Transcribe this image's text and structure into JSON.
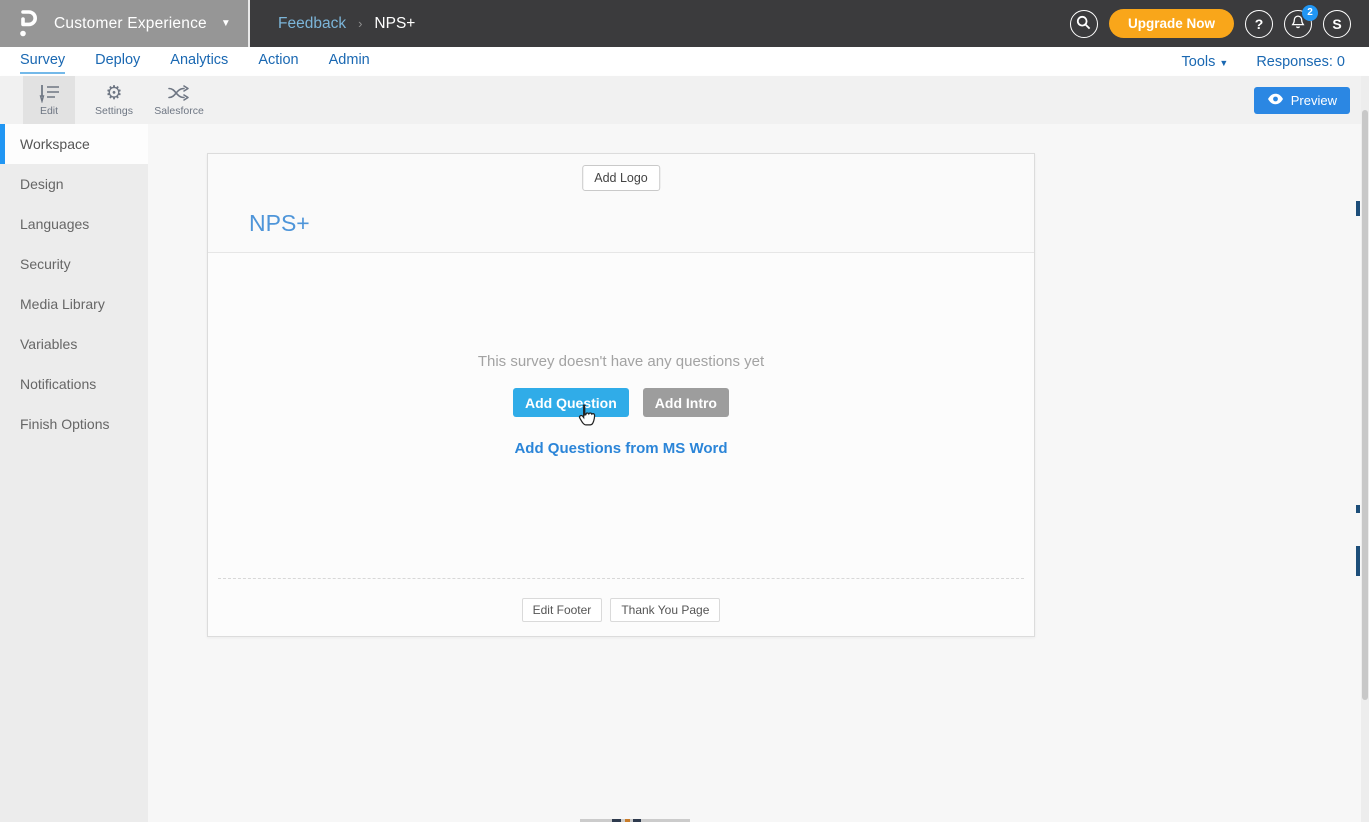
{
  "header": {
    "workspace_label": "Customer Experience",
    "breadcrumb": {
      "parent": "Feedback",
      "separator": "›",
      "current": "NPS+"
    },
    "upgrade_label": "Upgrade Now",
    "help_label": "?",
    "avatar_label": "S",
    "notification_count": "2"
  },
  "nav": {
    "tabs": [
      {
        "label": "Survey",
        "active": true
      },
      {
        "label": "Deploy",
        "active": false
      },
      {
        "label": "Analytics",
        "active": false
      },
      {
        "label": "Action",
        "active": false
      },
      {
        "label": "Admin",
        "active": false
      }
    ],
    "tools_label": "Tools",
    "responses_label": "Responses: 0"
  },
  "toolbar": {
    "items": [
      {
        "label": "Edit",
        "active": true
      },
      {
        "label": "Settings",
        "active": false
      },
      {
        "label": "Salesforce",
        "active": false
      }
    ],
    "preview_label": "Preview"
  },
  "sidebar": {
    "items": [
      {
        "label": "Workspace",
        "active": true
      },
      {
        "label": "Design",
        "active": false
      },
      {
        "label": "Languages",
        "active": false
      },
      {
        "label": "Security",
        "active": false
      },
      {
        "label": "Media Library",
        "active": false
      },
      {
        "label": "Variables",
        "active": false
      },
      {
        "label": "Notifications",
        "active": false
      },
      {
        "label": "Finish Options",
        "active": false
      }
    ]
  },
  "survey": {
    "add_logo_label": "Add Logo",
    "title": "NPS+",
    "empty_message": "This survey doesn't have any questions yet",
    "add_question_label": "Add Question",
    "add_intro_label": "Add Intro",
    "ms_word_link": "Add Questions from MS Word",
    "edit_footer_label": "Edit Footer",
    "thank_you_label": "Thank You Page"
  },
  "colors": {
    "header_left_bg": "#969696",
    "header_right_bg": "#3b3b3d",
    "breadcrumb_link_blue": "#7cb5d9",
    "upgrade_orange": "#f9a61a",
    "badge_blue": "#2196f3",
    "nav_blue": "#1a68b2",
    "active_tab_underline": "#74b9e9",
    "preview_blue": "#2b87e3",
    "sidebar_active_bar": "#2196f3",
    "survey_title_blue": "#4e95d9",
    "add_question_blue": "#30ace8",
    "add_intro_gray": "#9d9d9d",
    "link_blue": "#2b85d8"
  }
}
